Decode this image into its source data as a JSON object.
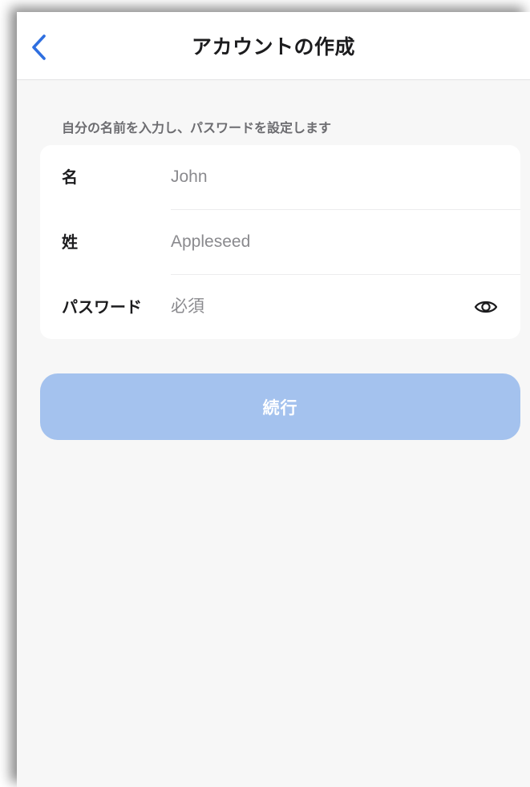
{
  "header": {
    "title": "アカウントの作成",
    "back_icon": "chevron-left-icon"
  },
  "form": {
    "caption": "自分の名前を入力し、パスワードを設定します",
    "fields": [
      {
        "label": "名",
        "placeholder": "John",
        "value": ""
      },
      {
        "label": "姓",
        "placeholder": "Appleseed",
        "value": ""
      },
      {
        "label": "パスワード",
        "placeholder": "必須",
        "value": "",
        "toggle_icon": "eye-icon"
      }
    ]
  },
  "actions": {
    "continue_label": "続行",
    "continue_enabled": false
  },
  "colors": {
    "accent": "#2f6fe0",
    "button_disabled": "#a4c2ee",
    "background": "#f7f7f7"
  }
}
